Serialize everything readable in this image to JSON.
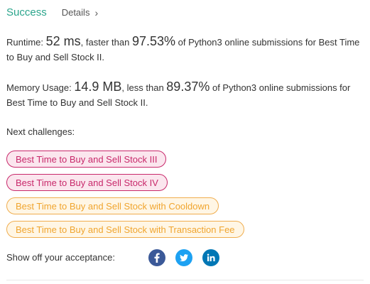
{
  "header": {
    "status": "Success",
    "details_label": "Details",
    "details_chevron": "›"
  },
  "runtime": {
    "label": "Runtime: ",
    "value": "52 ms",
    "mid": ", faster than ",
    "percent": "97.53%",
    "tail": " of Python3 online submissions for Best Time to Buy and Sell Stock II."
  },
  "memory": {
    "label": "Memory Usage: ",
    "value": "14.9 MB",
    "mid": ", less than ",
    "percent": "89.37%",
    "tail": " of Python3 online submissions for Best Time to Buy and Sell Stock II."
  },
  "next": {
    "label": "Next challenges:",
    "items": [
      {
        "title": "Best Time to Buy and Sell Stock III",
        "difficulty": "hard"
      },
      {
        "title": "Best Time to Buy and Sell Stock IV",
        "difficulty": "hard"
      },
      {
        "title": "Best Time to Buy and Sell Stock with Cooldown",
        "difficulty": "medium"
      },
      {
        "title": "Best Time to Buy and Sell Stock with Transaction Fee",
        "difficulty": "medium"
      }
    ]
  },
  "share": {
    "label": "Show off your acceptance:",
    "icons": [
      "facebook-icon",
      "twitter-icon",
      "linkedin-icon"
    ]
  },
  "colors": {
    "success": "#2ba58c",
    "hard": "#c8296b",
    "medium": "#f0ad4e",
    "facebook": "#3b5998",
    "twitter": "#1da1f2",
    "linkedin": "#0077b5"
  }
}
